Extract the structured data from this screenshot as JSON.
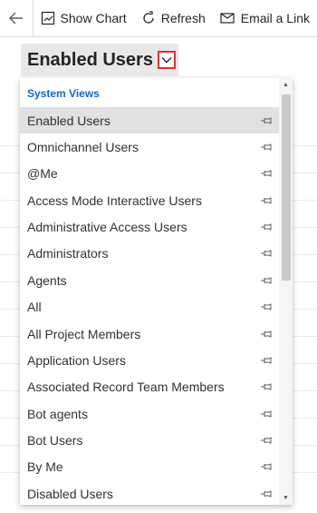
{
  "toolbar": {
    "show_chart": "Show Chart",
    "refresh": "Refresh",
    "email_link": "Email a Link"
  },
  "view_selector": {
    "title": "Enabled Users"
  },
  "dropdown": {
    "group_label": "System Views",
    "items": [
      {
        "label": "Enabled Users",
        "selected": true
      },
      {
        "label": "Omnichannel Users"
      },
      {
        "label": "@Me"
      },
      {
        "label": "Access Mode Interactive Users"
      },
      {
        "label": "Administrative Access Users"
      },
      {
        "label": "Administrators"
      },
      {
        "label": "Agents"
      },
      {
        "label": "All"
      },
      {
        "label": "All Project Members"
      },
      {
        "label": "Application Users"
      },
      {
        "label": "Associated Record Team Members"
      },
      {
        "label": "Bot agents"
      },
      {
        "label": "Bot Users"
      },
      {
        "label": "By Me"
      },
      {
        "label": "Disabled Users"
      }
    ]
  },
  "icons": {
    "back": "arrow-left-icon",
    "chart": "chart-icon",
    "refresh": "refresh-icon",
    "email": "email-link-icon",
    "chevron": "chevron-down-icon",
    "pin": "pin-icon"
  },
  "colors": {
    "accent": "#1366c9",
    "highlight_border": "#d13438",
    "selected_bg": "#e1e1e1"
  }
}
